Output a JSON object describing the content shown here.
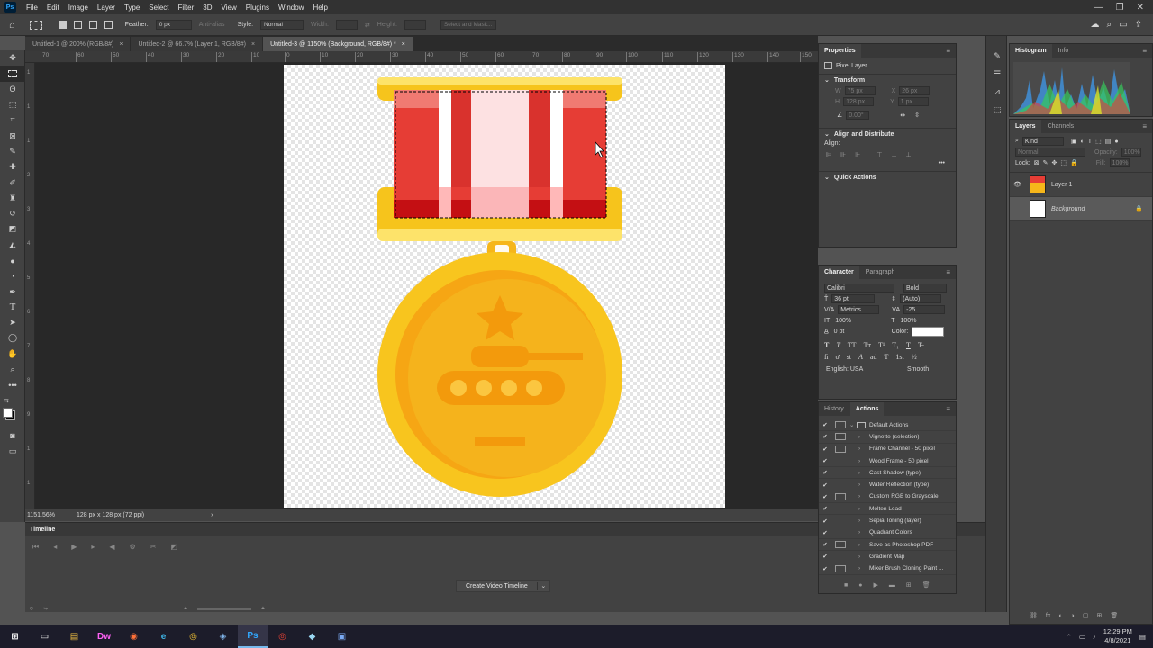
{
  "app": {
    "logo": "Ps",
    "window_controls": [
      "—",
      "❐",
      "✕"
    ]
  },
  "menu": [
    "File",
    "Edit",
    "Image",
    "Layer",
    "Type",
    "Select",
    "Filter",
    "3D",
    "View",
    "Plugins",
    "Window",
    "Help"
  ],
  "options_bar": {
    "feather_label": "Feather:",
    "feather_value": "0 px",
    "antialias_label": "Anti-alias",
    "style_label": "Style:",
    "style_value": "Normal",
    "width_label": "Width:",
    "height_label": "Height:",
    "select_mask": "Select and Mask..."
  },
  "doc_tabs": [
    {
      "label": "Untitled-1 @ 200% (RGB/8#)",
      "close": "×"
    },
    {
      "label": "Untitled-2 @ 66.7% (Layer 1, RGB/8#)",
      "close": "×"
    },
    {
      "label": "Untitled-3 @ 1150% (Background, RGB/8#) *",
      "close": "×"
    }
  ],
  "ruler_top": [
    "70",
    "60",
    "50",
    "40",
    "30",
    "20",
    "10",
    "0",
    "10",
    "20",
    "30",
    "40",
    "50",
    "60",
    "70",
    "80",
    "90",
    "100",
    "110",
    "120",
    "130",
    "140",
    "150"
  ],
  "ruler_left": [
    "1",
    "1",
    "1",
    "2",
    "3",
    "4",
    "5",
    "6",
    "7",
    "8",
    "9",
    "1",
    "1"
  ],
  "status_bar": {
    "zoom": "1151.56%",
    "doc_info": "128 px x 128 px (72 ppi)",
    "arrow": "›"
  },
  "timeline": {
    "title": "Timeline",
    "create_button": "Create Video Timeline",
    "create_arrow": "⌄"
  },
  "properties": {
    "title": "Properties",
    "pixel_layer": "Pixel Layer",
    "transform": "Transform",
    "w_label": "W",
    "w_value": "75 px",
    "h_label": "H",
    "h_value": "128 px",
    "x_label": "X",
    "x_value": "26 px",
    "y_label": "Y",
    "y_value": "1 px",
    "angle_value": "0.00°",
    "align_title": "Align and Distribute",
    "align_label": "Align:",
    "more": "•••",
    "quick_actions": "Quick Actions"
  },
  "character": {
    "tabs": [
      "Character",
      "Paragraph"
    ],
    "font_family": "Calibri",
    "font_style": "Bold",
    "size": "36 pt",
    "leading": "(Auto)",
    "kerning": "Metrics",
    "tracking": "-25",
    "vscale": "100%",
    "hscale": "100%",
    "baseline": "0 pt",
    "color_label": "Color:",
    "color_value": "#ffffff",
    "language": "English: USA",
    "antialias": "Smooth",
    "type_styles": [
      "T",
      "T",
      "TT",
      "Tт",
      "T¹",
      "T₁",
      "T",
      "T̶"
    ],
    "opentype": [
      "ﬁ",
      "ơ",
      "st",
      "A",
      "ad",
      "T",
      "1st",
      "½"
    ]
  },
  "history_actions": {
    "tabs": [
      "History",
      "Actions"
    ],
    "actions": [
      {
        "label": "Default Actions",
        "dialog": true,
        "folder": true
      },
      {
        "label": "Vignette (selection)",
        "dialog": true
      },
      {
        "label": "Frame Channel - 50 pixel",
        "dialog": true
      },
      {
        "label": "Wood Frame - 50 pixel",
        "dialog": false
      },
      {
        "label": "Cast Shadow (type)",
        "dialog": false
      },
      {
        "label": "Water Reflection (type)",
        "dialog": false
      },
      {
        "label": "Custom RGB to Grayscale",
        "dialog": true
      },
      {
        "label": "Molten Lead",
        "dialog": false
      },
      {
        "label": "Sepia Toning (layer)",
        "dialog": false
      },
      {
        "label": "Quadrant Colors",
        "dialog": false
      },
      {
        "label": "Save as Photoshop PDF",
        "dialog": true
      },
      {
        "label": "Gradient Map",
        "dialog": false
      },
      {
        "label": "Mixer Brush Cloning Paint ...",
        "dialog": true
      }
    ]
  },
  "histogram": {
    "tabs": [
      "Histogram",
      "Info"
    ]
  },
  "layers": {
    "tabs": [
      "Layers",
      "Channels"
    ],
    "kind": "Kind",
    "blend_mode": "Normal",
    "opacity_label": "Opacity:",
    "opacity_value": "100%",
    "lock_label": "Lock:",
    "fill_label": "Fill:",
    "fill_value": "100%",
    "items": [
      {
        "name": "Layer 1",
        "visible": true,
        "selected": false
      },
      {
        "name": "Background",
        "visible": false,
        "selected": true,
        "locked": true
      }
    ],
    "footer_icons": [
      "⛓",
      "fx",
      "◐",
      "◑",
      "▢",
      "⊞",
      "🗑"
    ]
  },
  "taskbar": {
    "time": "12:29 PM",
    "date": "4/8/2021",
    "apps": [
      "⊞",
      "▭",
      "▤",
      "Dw",
      "◉",
      "e",
      "◎",
      "◈",
      "Ps",
      "◎",
      "◆",
      "▣"
    ]
  },
  "colors": {
    "ps_blue": "#31a8ff",
    "ribbon_red": "#e63d35",
    "medal_gold": "#f6b61a"
  }
}
